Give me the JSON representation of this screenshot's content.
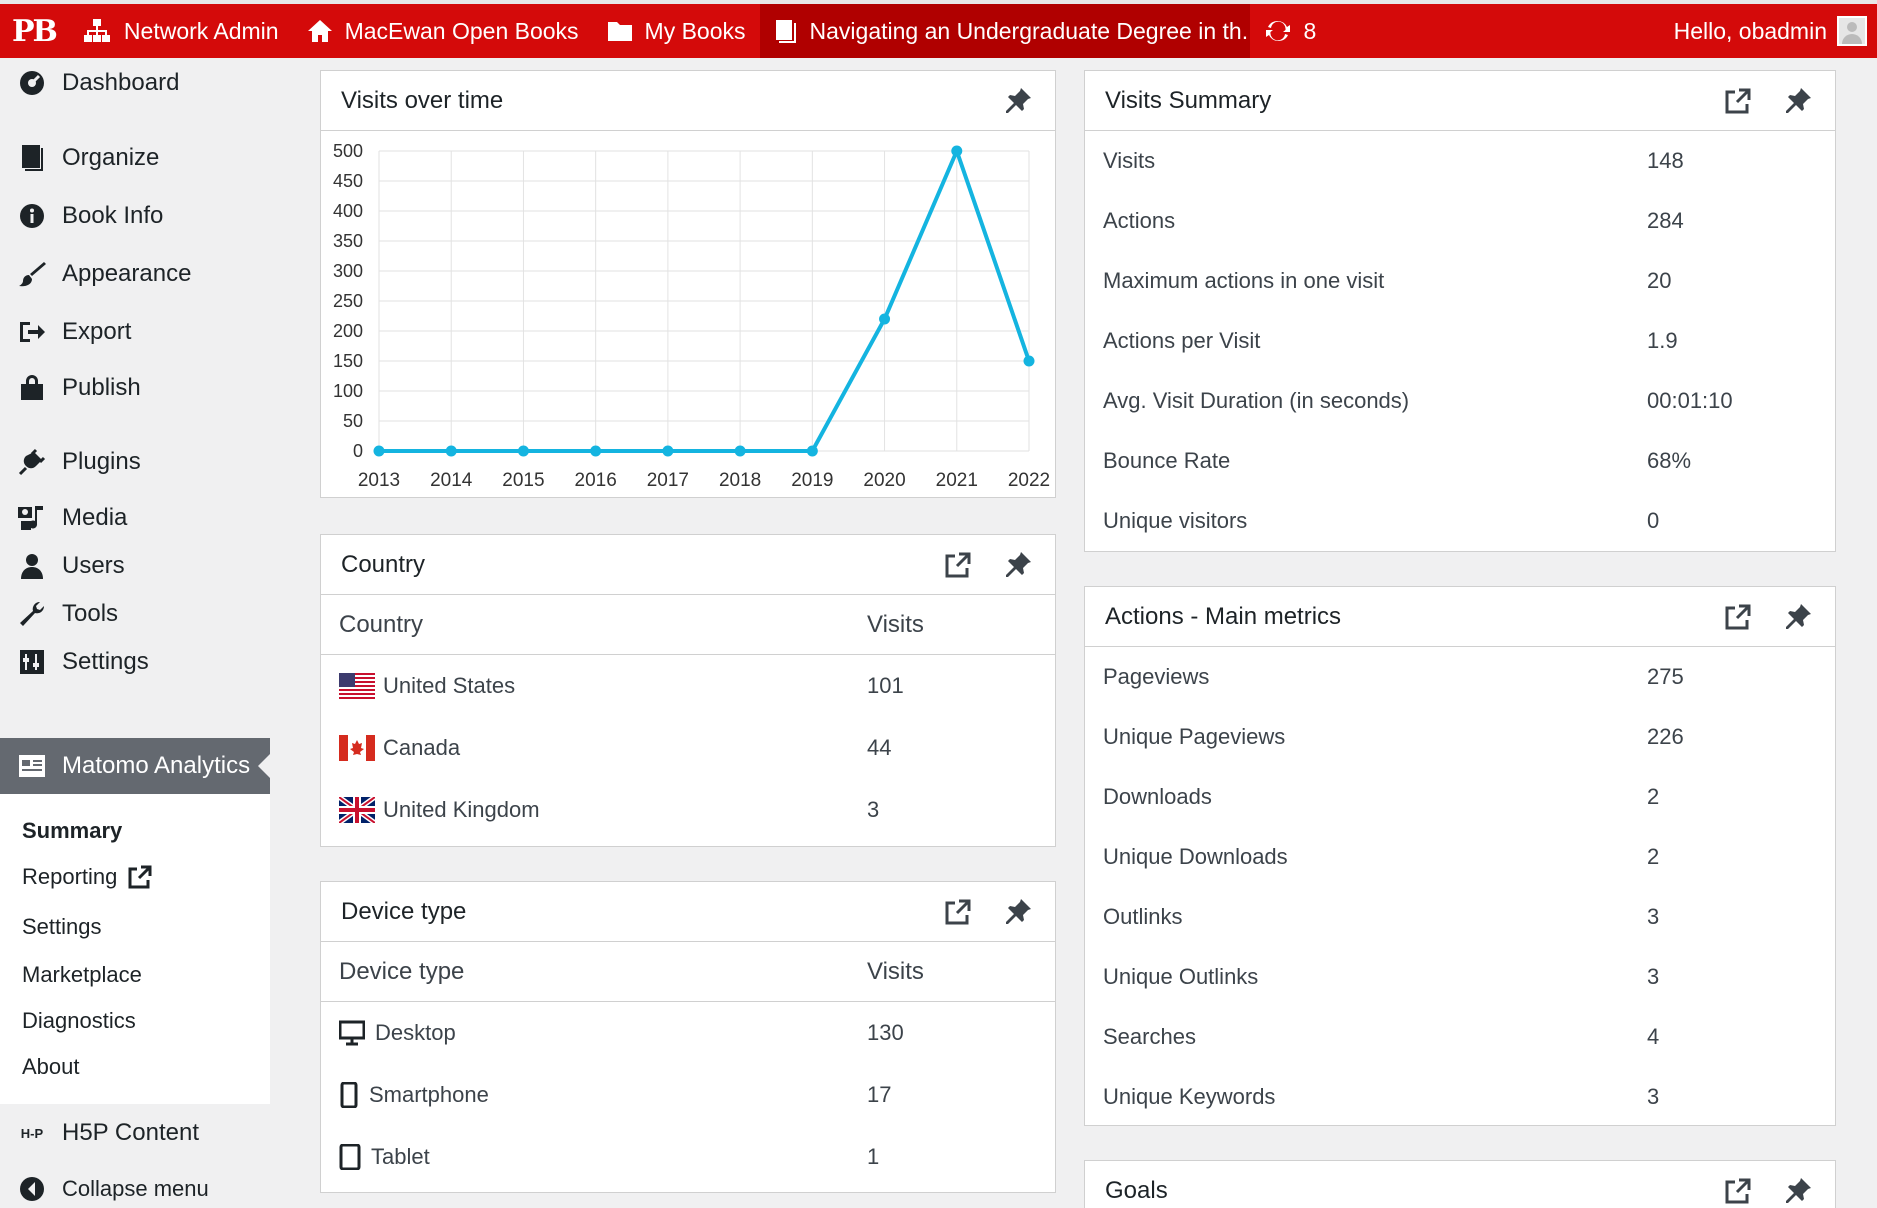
{
  "adminbar": {
    "logo": "PB",
    "network_admin": "Network Admin",
    "site": "MacEwan Open Books",
    "my_books": "My Books",
    "current_book": "Navigating an Undergraduate Degree in th...",
    "updates_count": "8",
    "greeting": "Hello, obadmin"
  },
  "sidebar": {
    "items": [
      {
        "label": "Dashboard",
        "icon": "dashboard-icon"
      },
      {
        "label": "Organize",
        "icon": "book-icon"
      },
      {
        "label": "Book Info",
        "icon": "info-icon"
      },
      {
        "label": "Appearance",
        "icon": "brush-icon"
      },
      {
        "label": "Export",
        "icon": "export-icon"
      },
      {
        "label": "Publish",
        "icon": "publish-icon"
      },
      {
        "label": "Plugins",
        "icon": "plug-icon"
      },
      {
        "label": "Media",
        "icon": "media-icon"
      },
      {
        "label": "Users",
        "icon": "users-icon"
      },
      {
        "label": "Tools",
        "icon": "wrench-icon"
      },
      {
        "label": "Settings",
        "icon": "settings-icon"
      },
      {
        "label": "Matomo Analytics",
        "icon": "analytics-icon"
      },
      {
        "label": "H5P Content",
        "icon": "h5p-icon"
      },
      {
        "label": "Collapse menu",
        "icon": "collapse-icon"
      }
    ],
    "submenu": [
      "Summary",
      "Reporting",
      "Settings",
      "Marketplace",
      "Diagnostics",
      "About"
    ]
  },
  "visits_over_time": {
    "title": "Visits over time"
  },
  "chart_data": {
    "type": "line",
    "x": [
      "2013",
      "2014",
      "2015",
      "2016",
      "2017",
      "2018",
      "2019",
      "2020",
      "2021",
      "2022"
    ],
    "series": [
      {
        "values": [
          0,
          0,
          0,
          0,
          0,
          0,
          0,
          220,
          500,
          150
        ]
      }
    ],
    "ylim": [
      0,
      500
    ],
    "yticks": [
      "0",
      "50",
      "100",
      "150",
      "200",
      "250",
      "300",
      "350",
      "400",
      "450",
      "500"
    ],
    "grid": true,
    "color": "#14b4e0"
  },
  "country": {
    "title": "Country",
    "col1": "Country",
    "col2": "Visits",
    "rows": [
      {
        "name": "United States",
        "visits": "101"
      },
      {
        "name": "Canada",
        "visits": "44"
      },
      {
        "name": "United Kingdom",
        "visits": "3"
      }
    ]
  },
  "device": {
    "title": "Device type",
    "col1": "Device type",
    "col2": "Visits",
    "rows": [
      {
        "name": "Desktop",
        "visits": "130"
      },
      {
        "name": "Smartphone",
        "visits": "17"
      },
      {
        "name": "Tablet",
        "visits": "1"
      }
    ]
  },
  "visits_summary": {
    "title": "Visits Summary",
    "rows": [
      {
        "label": "Visits",
        "value": "148"
      },
      {
        "label": "Actions",
        "value": "284"
      },
      {
        "label": "Maximum actions in one visit",
        "value": "20"
      },
      {
        "label": "Actions per Visit",
        "value": "1.9"
      },
      {
        "label": "Avg. Visit Duration (in seconds)",
        "value": "00:01:10"
      },
      {
        "label": "Bounce Rate",
        "value": "68%"
      },
      {
        "label": "Unique visitors",
        "value": "0"
      }
    ]
  },
  "actions": {
    "title": "Actions - Main metrics",
    "rows": [
      {
        "label": "Pageviews",
        "value": "275"
      },
      {
        "label": "Unique Pageviews",
        "value": "226"
      },
      {
        "label": "Downloads",
        "value": "2"
      },
      {
        "label": "Unique Downloads",
        "value": "2"
      },
      {
        "label": "Outlinks",
        "value": "3"
      },
      {
        "label": "Unique Outlinks",
        "value": "3"
      },
      {
        "label": "Searches",
        "value": "4"
      },
      {
        "label": "Unique Keywords",
        "value": "3"
      }
    ]
  },
  "goals": {
    "title": "Goals"
  }
}
